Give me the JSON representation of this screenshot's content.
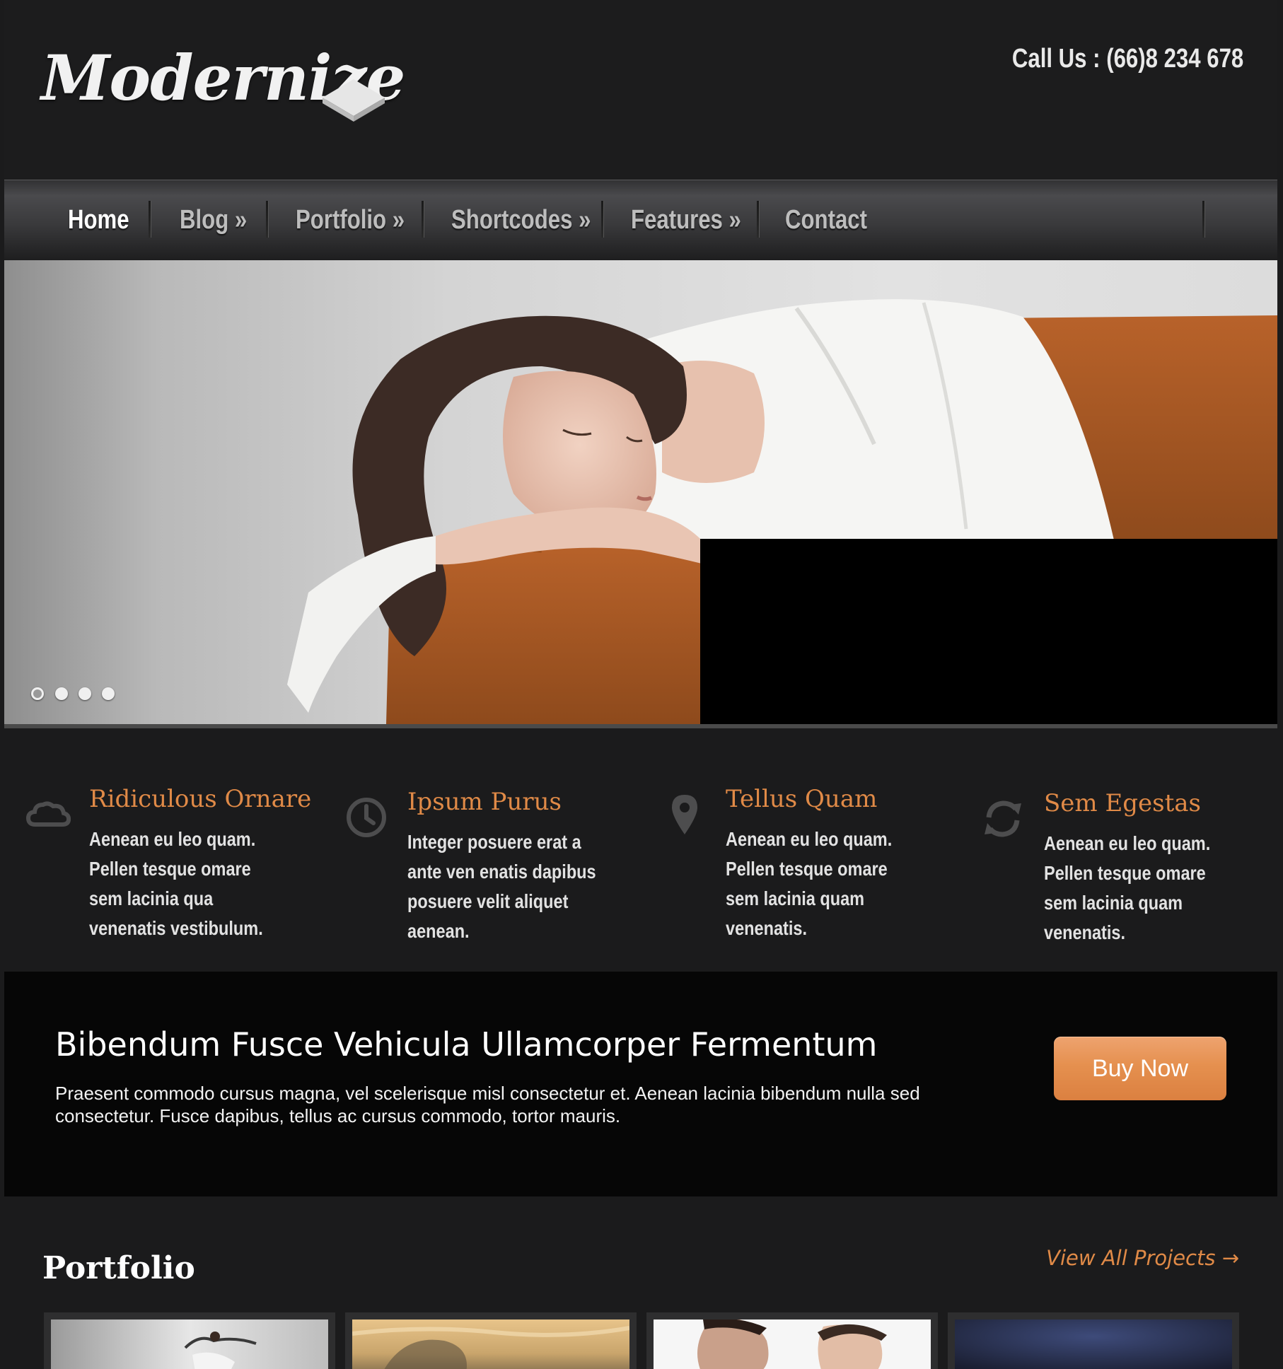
{
  "header": {
    "logo_text": "Modernize",
    "call_us": "Call Us : (66)8 234 678"
  },
  "nav": {
    "items": [
      {
        "label": "Home"
      },
      {
        "label": "Blog »"
      },
      {
        "label": "Portfolio »"
      },
      {
        "label": "Shortcodes »"
      },
      {
        "label": "Features »"
      },
      {
        "label": "Contact"
      }
    ],
    "active_label": "Home"
  },
  "slider": {
    "slide_count": 4,
    "active_index": 0
  },
  "features": [
    {
      "icon": "cloud-icon",
      "title": "Ridiculous Ornare",
      "text": "Aenean eu leo quam. Pellen tesque omare sem lacinia qua venenatis vestibulum."
    },
    {
      "icon": "clock-icon",
      "title": "Ipsum Purus",
      "text": "Integer posuere erat a ante ven enatis dapibus posuere velit aliquet aenean."
    },
    {
      "icon": "map-pin-icon",
      "title": "Tellus Quam",
      "text": "Aenean eu leo quam. Pellen tesque omare sem lacinia quam venenatis."
    },
    {
      "icon": "refresh-icon",
      "title": "Sem Egestas",
      "text": "Aenean eu leo quam. Pellen tesque omare sem lacinia quam venenatis."
    }
  ],
  "cta": {
    "title": "Bibendum Fusce Vehicula Ullamcorper Fermentum",
    "text": "Praesent commodo cursus magna, vel scelerisque misl consectetur et. Aenean lacinia bibendum nulla sed consectetur. Fusce dapibus, tellus ac cursus commodo, tortor mauris.",
    "button_label": "Buy Now"
  },
  "portfolio": {
    "title": "Portfolio",
    "view_all_label": "View All Projects →",
    "thumbnail_count": 4
  },
  "colors": {
    "accent": "#e08a47",
    "page_bg": "#1b1b1c",
    "cta_bg": "#060606"
  }
}
